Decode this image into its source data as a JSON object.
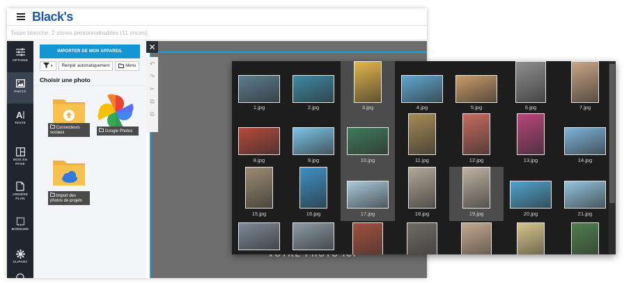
{
  "app": {
    "brand": "Black's",
    "product_title": "Tasse blanche, 2 zones personnalisables (11 onces)"
  },
  "tools": [
    {
      "key": "options",
      "label": "OPTIONS",
      "icon": "sliders-icon",
      "active": false
    },
    {
      "key": "photo",
      "label": "PHOTO",
      "icon": "image-icon",
      "active": true
    },
    {
      "key": "texte",
      "label": "TEXTE",
      "icon": "text-icon",
      "active": false
    },
    {
      "key": "mise",
      "label": "MISE EN PAGE",
      "icon": "layout-icon",
      "active": false
    },
    {
      "key": "arriere",
      "label": "ARRIÈRE PLAN",
      "icon": "background-icon",
      "active": false
    },
    {
      "key": "bordure",
      "label": "BORDURE",
      "icon": "border-icon",
      "active": false
    },
    {
      "key": "clipart",
      "label": "CLIPART",
      "icon": "clipart-icon",
      "active": false
    }
  ],
  "panel": {
    "import_label": "IMPORTER DE MON APPAREIL",
    "autofill_label": "Remplir automatiquement",
    "menu_label": "Menu",
    "title": "Choisir une photo",
    "sources": [
      {
        "label": "Connecteurs sociaux",
        "icon": "folder-upload-icon"
      },
      {
        "label": "Google Photos",
        "icon": "google-photos-icon"
      },
      {
        "label": "Import des photos de projets",
        "icon": "folder-cloud-icon"
      }
    ]
  },
  "canvas": {
    "placeholder": "VOTRE PHOTO ICI"
  },
  "gallery": {
    "selected": [
      "3.jpg",
      "10.jpg",
      "17.jpg",
      "19.jpg"
    ],
    "photos": [
      {
        "name": "1.jpg",
        "color": "#5b7d8f"
      },
      {
        "name": "2.jpg",
        "color": "#3d8aa3"
      },
      {
        "name": "3.jpg",
        "color": "#e2b64a"
      },
      {
        "name": "4.jpg",
        "color": "#5fa8d0"
      },
      {
        "name": "5.jpg",
        "color": "#c99b6a"
      },
      {
        "name": "6.jpg",
        "color": "#8e8e8e"
      },
      {
        "name": "7.jpg",
        "color": "#caa586"
      },
      {
        "name": "8.jpg",
        "color": "#b54a3b"
      },
      {
        "name": "9.jpg",
        "color": "#7cc3e4"
      },
      {
        "name": "10.jpg",
        "color": "#3f7a5a"
      },
      {
        "name": "11.jpg",
        "color": "#a58a56"
      },
      {
        "name": "12.jpg",
        "color": "#c66b5e"
      },
      {
        "name": "13.jpg",
        "color": "#b8457a"
      },
      {
        "name": "14.jpg",
        "color": "#7fb4d9"
      },
      {
        "name": "15.jpg",
        "color": "#9c8b72"
      },
      {
        "name": "16.jpg",
        "color": "#3d90c5"
      },
      {
        "name": "17.jpg",
        "color": "#a9c9dc"
      },
      {
        "name": "18.jpg",
        "color": "#b3a899"
      },
      {
        "name": "19.jpg",
        "color": "#bfb2a2"
      },
      {
        "name": "20.jpg",
        "color": "#4ea5cf"
      },
      {
        "name": "21.jpg",
        "color": "#93c5e0"
      },
      {
        "name": "",
        "color": "#7d8a98"
      },
      {
        "name": "",
        "color": "#8c9aa6"
      },
      {
        "name": "",
        "color": "#a0503d"
      },
      {
        "name": "",
        "color": "#6f6a64"
      },
      {
        "name": "",
        "color": "#c4a88e"
      },
      {
        "name": "",
        "color": "#d6c48a"
      },
      {
        "name": "",
        "color": "#4f7d4b"
      }
    ]
  }
}
